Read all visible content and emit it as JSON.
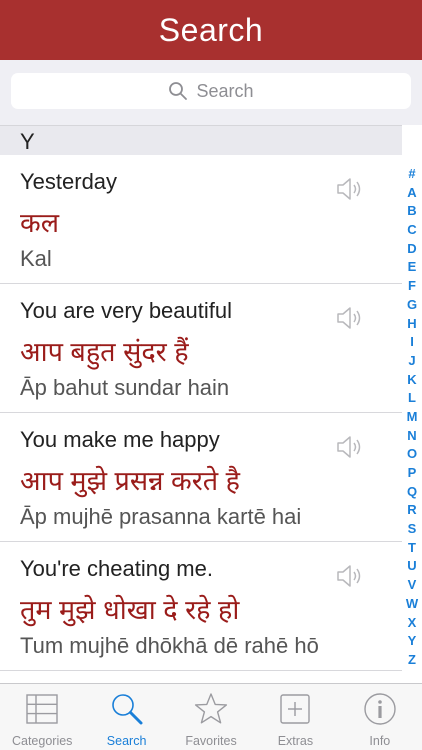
{
  "header": {
    "title": "Search"
  },
  "search": {
    "placeholder": "Search"
  },
  "section": {
    "letter": "Y"
  },
  "entries": [
    {
      "english": "Yesterday",
      "hindi": "कल",
      "translit": "Kal"
    },
    {
      "english": "You are very beautiful",
      "hindi": "आप बहुत सुंदर हैं",
      "translit": "Āp bahut sundar hain"
    },
    {
      "english": "You make me happy",
      "hindi": "आप मुझे प्रसन्न करते है",
      "translit": "Āp mujhē prasanna kartē hai"
    },
    {
      "english": "You're cheating me.",
      "hindi": "तुम मुझे धोखा दे रहे हो",
      "translit": "Tum mujhē dhōkhā dē rahē hō"
    }
  ],
  "index_letters": [
    "#",
    "A",
    "B",
    "C",
    "D",
    "E",
    "F",
    "G",
    "H",
    "I",
    "J",
    "K",
    "L",
    "M",
    "N",
    "O",
    "P",
    "Q",
    "R",
    "S",
    "T",
    "U",
    "V",
    "W",
    "X",
    "Y",
    "Z"
  ],
  "tabs": [
    {
      "label": "Categories",
      "icon": "list-icon"
    },
    {
      "label": "Search",
      "icon": "search-icon"
    },
    {
      "label": "Favorites",
      "icon": "star-icon"
    },
    {
      "label": "Extras",
      "icon": "plus-square-icon"
    },
    {
      "label": "Info",
      "icon": "info-icon"
    }
  ],
  "colors": {
    "header": "#a8302f",
    "hindi_text": "#9a1c1a",
    "accent": "#1a7fd8"
  }
}
